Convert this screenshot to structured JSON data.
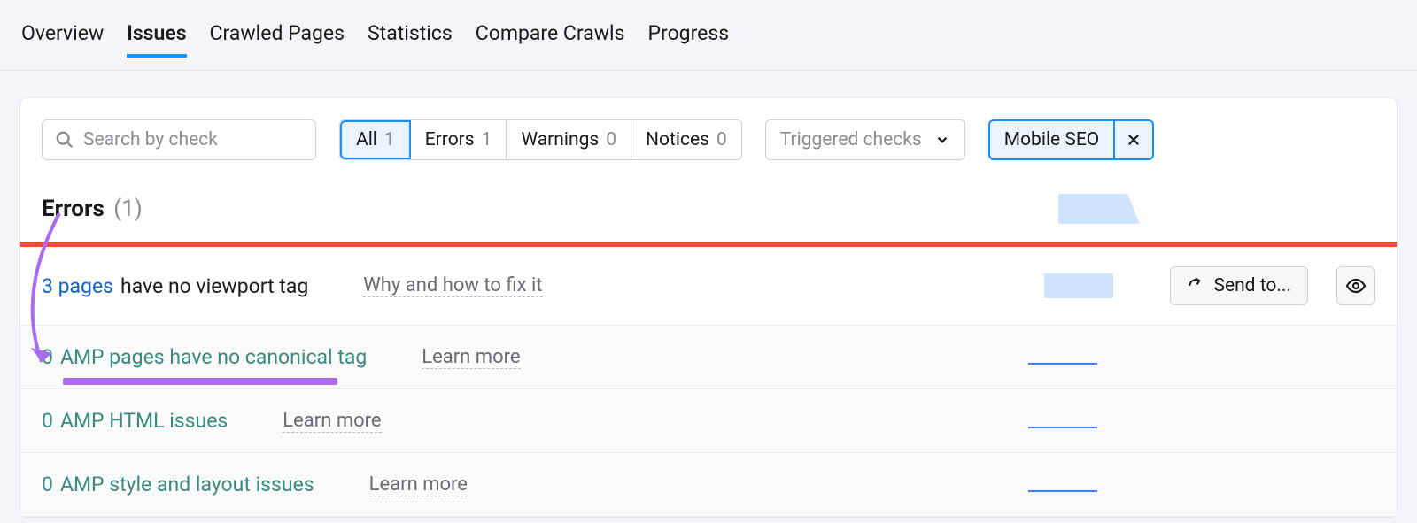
{
  "tabs": {
    "overview": "Overview",
    "issues": "Issues",
    "crawled_pages": "Crawled Pages",
    "statistics": "Statistics",
    "compare_crawls": "Compare Crawls",
    "progress": "Progress"
  },
  "search": {
    "placeholder": "Search by check"
  },
  "filters": {
    "all": {
      "label": "All",
      "count": "1"
    },
    "errors": {
      "label": "Errors",
      "count": "1"
    },
    "warnings": {
      "label": "Warnings",
      "count": "0"
    },
    "notices": {
      "label": "Notices",
      "count": "0"
    }
  },
  "dropdown": {
    "label": "Triggered checks"
  },
  "chip": {
    "label": "Mobile SEO"
  },
  "section": {
    "title": "Errors",
    "count": "(1)"
  },
  "rows": {
    "viewport": {
      "count_text": "3 pages",
      "rest_text": "have no viewport tag",
      "why": "Why and how to fix it"
    },
    "amp_canonical": {
      "count_text": "0",
      "rest_text": "AMP pages have no canonical tag",
      "learn": "Learn more"
    },
    "amp_html": {
      "count_text": "0",
      "rest_text": "AMP HTML issues",
      "learn": "Learn more"
    },
    "amp_style": {
      "count_text": "0",
      "rest_text": "AMP style and layout issues",
      "learn": "Learn more"
    }
  },
  "actions": {
    "send_to": "Send to..."
  }
}
